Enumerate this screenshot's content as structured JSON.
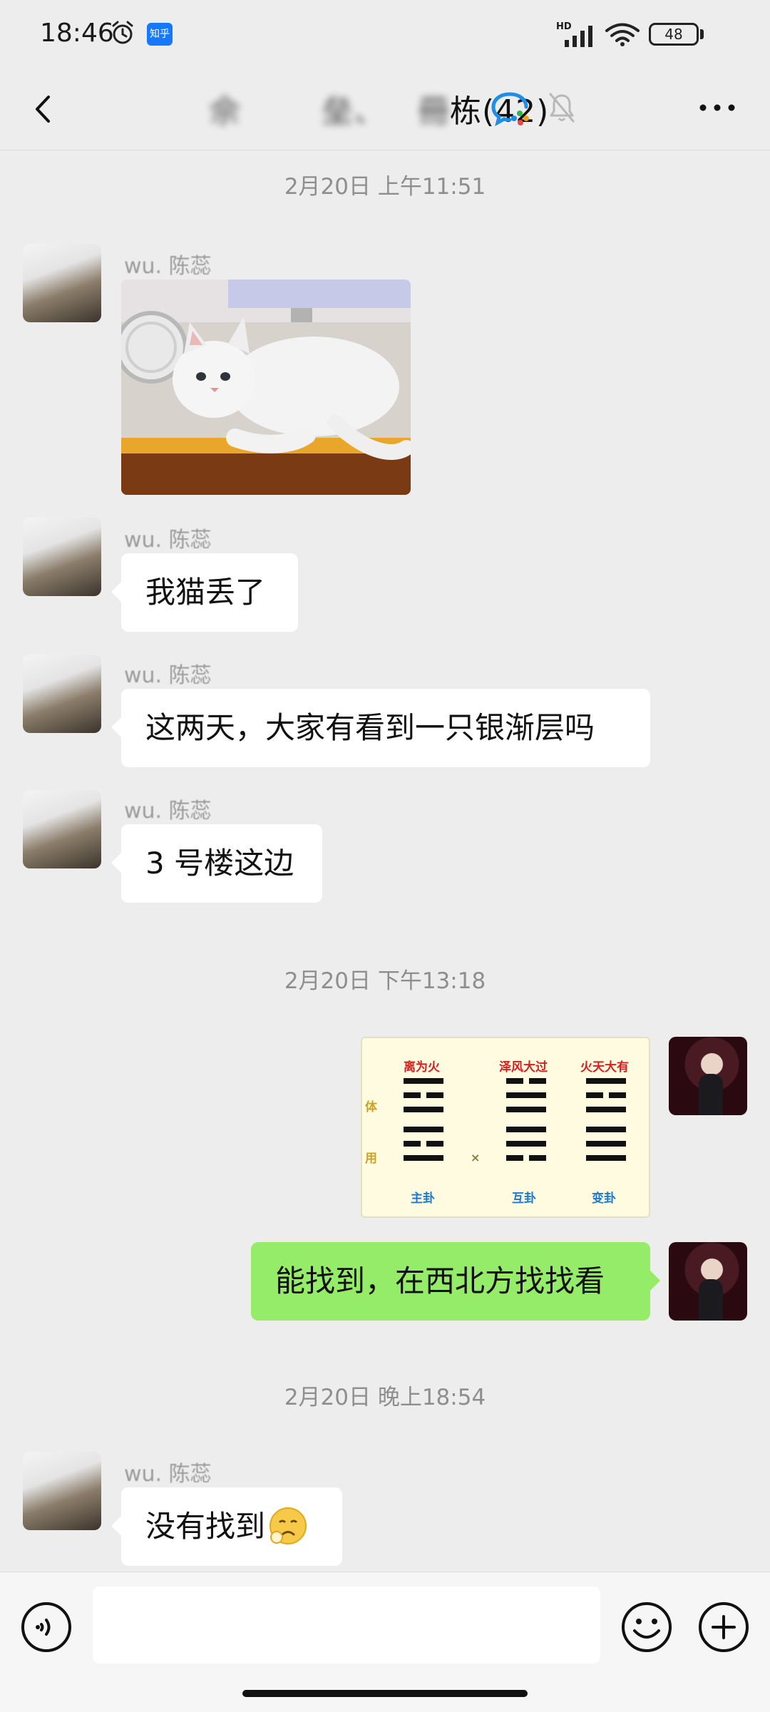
{
  "status_bar": {
    "time": "18:46",
    "app_badge": "知乎",
    "network_label": "HD",
    "battery": "48"
  },
  "header": {
    "title_visible": "栋(42)",
    "title_blurred_prefix": " 佘   垒、 冊"
  },
  "messages": {
    "ts1": "2月20日 上午11:51",
    "sender1": "wu. 陈蕊",
    "sender2": "wu. 陈蕊",
    "text2": "我猫丢了",
    "sender3": "wu. 陈蕊",
    "text3": "这两天，大家有看到一只银渐层吗",
    "sender4": "wu. 陈蕊",
    "text4": "3 号楼这边",
    "ts2": "2月20日 下午13:18",
    "text_reply": "能找到，在西北方找找看",
    "ts3": "2月20日 晚上18:54",
    "sender5": "wu. 陈蕊",
    "text5": "没有找到"
  },
  "hexagram_image": {
    "titles": [
      "离为火",
      "泽风大过",
      "火天大有"
    ],
    "side_top": "体",
    "side_bottom": "用",
    "middle_mark": "×",
    "footers": [
      "主卦",
      "互卦",
      "变卦"
    ]
  },
  "input_bar": {
    "placeholder": ""
  },
  "icons": {
    "back": "back-arrow-icon",
    "enterprise": "enterprise-chat-icon",
    "mute": "bell-muted-icon",
    "more": "more-dots-icon",
    "voice": "voice-icon",
    "emoji": "smiley-icon",
    "plus": "plus-icon"
  },
  "colors": {
    "background": "#ededed",
    "my_bubble": "#95ec69",
    "their_bubble": "#ffffff",
    "timestamp": "#8e8e8e"
  }
}
